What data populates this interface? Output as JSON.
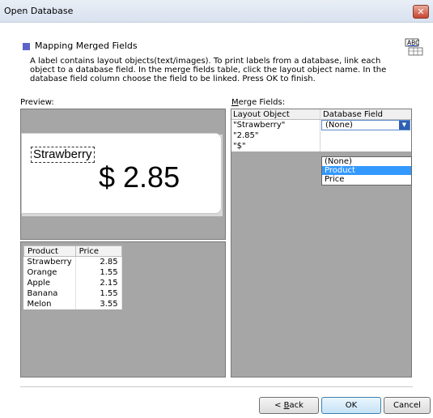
{
  "window": {
    "title": "Open Database",
    "close_label": "✕"
  },
  "header": {
    "title": "Mapping Merged Fields",
    "description": "A label contains layout objects(text/images). To print labels from a database, link each object to a database field. In the merge fields table, click the layout object name. In the database field column choose the field to be linked. Press OK to finish."
  },
  "preview": {
    "label": "Preview:",
    "objects": {
      "text": "Strawberry",
      "price": "$ 2.85"
    }
  },
  "database": {
    "columns": [
      "Product",
      "Price"
    ],
    "rows": [
      [
        "Strawberry",
        "2.85"
      ],
      [
        "Orange",
        "1.55"
      ],
      [
        "Apple",
        "2.15"
      ],
      [
        "Banana",
        "1.55"
      ],
      [
        "Melon",
        "3.55"
      ]
    ]
  },
  "merge": {
    "label_prefix": "M",
    "label_rest": "erge Fields:",
    "columns": [
      "Layout Object",
      "Database Field"
    ],
    "rows": [
      {
        "object": "\"Strawberry\"",
        "field": "(None)"
      },
      {
        "object": "\"2.85\"",
        "field": ""
      },
      {
        "object": "\"$\"",
        "field": ""
      }
    ],
    "dropdown_options": [
      "(None)",
      "Product",
      "Price"
    ],
    "selected_option": "Product"
  },
  "buttons": {
    "back_prefix": "< ",
    "back_underlined": "B",
    "back_rest": "ack",
    "ok": "OK",
    "cancel": "Cancel"
  },
  "colors": {
    "header_square": "#5a64c8",
    "selection": "#3399ff",
    "panel_bg": "#a6a6a6"
  },
  "icons": {
    "window_close": "close-icon",
    "layout_icon": "abc-table-icon",
    "combo_arrow": "chevron-down-icon"
  }
}
